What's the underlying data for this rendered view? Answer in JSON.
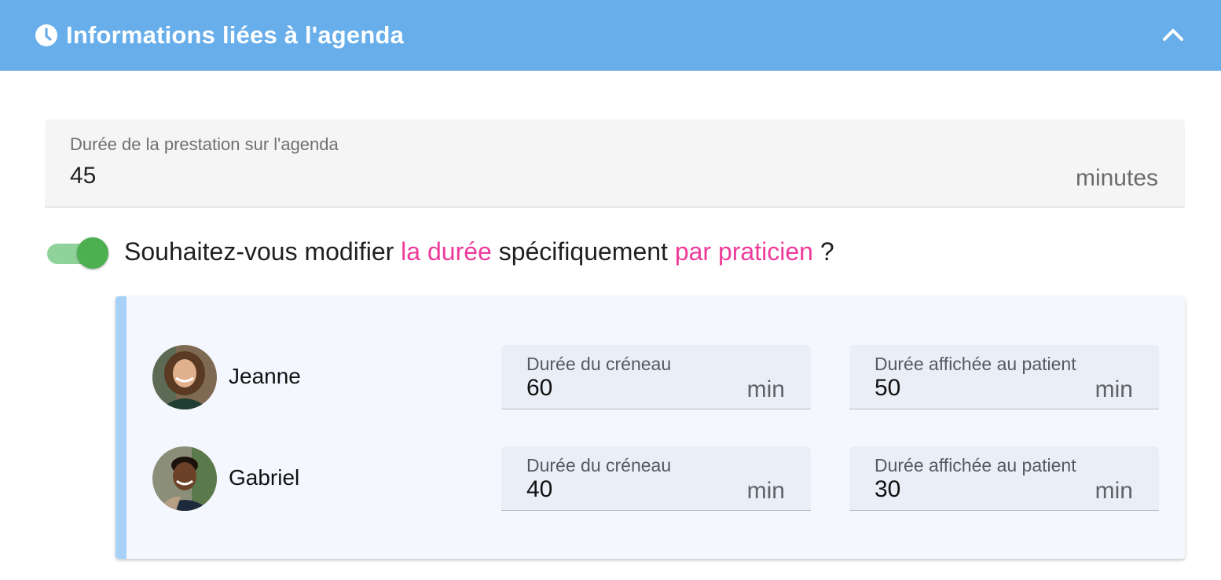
{
  "header": {
    "title": "Informations liées à l'agenda",
    "icon": "clock-icon",
    "collapse_icon": "chevron-up-icon",
    "background": "#67aeea"
  },
  "duration": {
    "label": "Durée de la prestation sur l'agenda",
    "value": "45",
    "suffix": "minutes"
  },
  "toggle": {
    "on": true,
    "question_prefix": "Souhaitez-vous modifier ",
    "highlight_1": "la durée",
    "question_middle": " spécifiquement ",
    "highlight_2": "par praticien",
    "question_suffix": " ?",
    "accent": "#ee3b9b"
  },
  "practitioners": [
    {
      "name": "Jeanne",
      "slot_label": "Durée du créneau",
      "slot_value": "60",
      "slot_suffix": "min",
      "display_label": "Durée affichée au patient",
      "display_value": "50",
      "display_suffix": "min"
    },
    {
      "name": "Gabriel",
      "slot_label": "Durée du créneau",
      "slot_value": "40",
      "slot_suffix": "min",
      "display_label": "Durée affichée au patient",
      "display_value": "30",
      "display_suffix": "min"
    }
  ]
}
